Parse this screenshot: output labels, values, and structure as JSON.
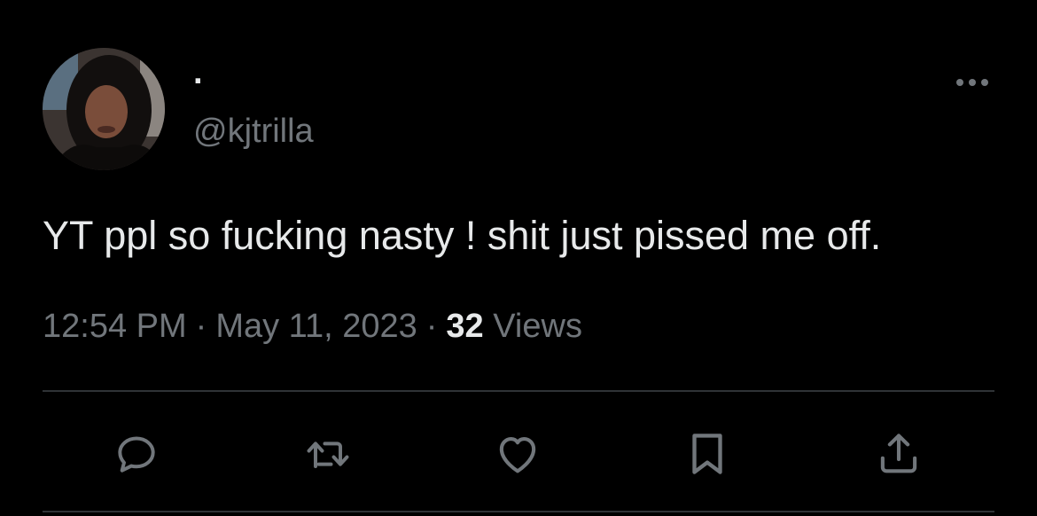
{
  "tweet": {
    "author": {
      "display_name": "·",
      "handle": "@kjtrilla"
    },
    "text": "YT ppl so fucking nasty ! shit just pissed me off.",
    "time": "12:54 PM",
    "separator": "·",
    "date": "May 11, 2023",
    "views_count": "32",
    "views_label": "Views"
  },
  "actions": [
    {
      "name": "reply",
      "icon": "reply-icon"
    },
    {
      "name": "retweet",
      "icon": "retweet-icon"
    },
    {
      "name": "like",
      "icon": "heart-icon"
    },
    {
      "name": "bookmark",
      "icon": "bookmark-icon"
    },
    {
      "name": "share",
      "icon": "share-icon"
    }
  ],
  "colors": {
    "background": "#000000",
    "primary_text": "#e7e9ea",
    "secondary_text": "#71767b",
    "divider": "#2f3336"
  }
}
